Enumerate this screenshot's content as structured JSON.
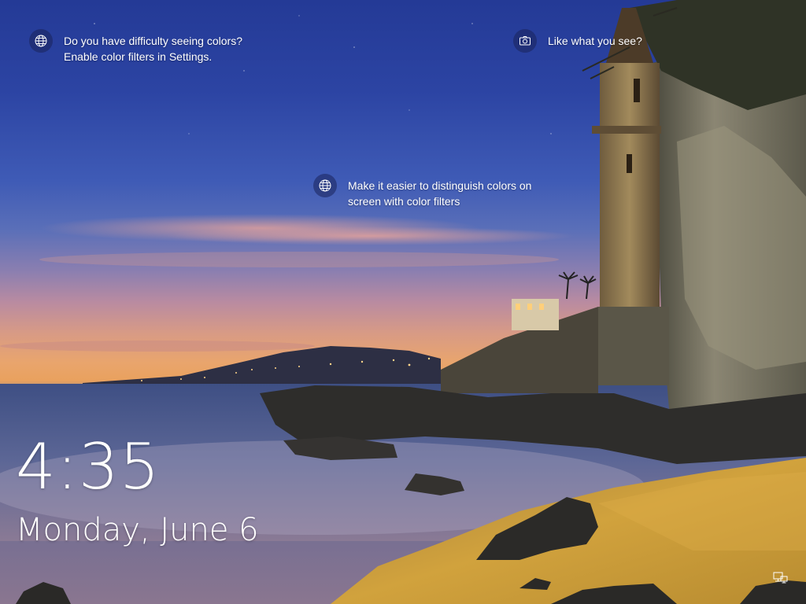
{
  "lock_screen": {
    "tips": [
      {
        "icon": "globe-icon",
        "line1": "Do you have difficulty seeing colors?",
        "line2": "Enable color filters in Settings."
      },
      {
        "icon": "globe-icon",
        "line1": "Make it easier to distinguish colors on",
        "line2": "screen with color filters"
      },
      {
        "icon": "camera-icon",
        "line1": "Like what you see?"
      }
    ],
    "time": "4:35",
    "date": "Monday, June 6",
    "status_icons": [
      "network-icon"
    ]
  },
  "colors": {
    "text": "#ffffff",
    "sky_top": "#243a96",
    "horizon": "#e9a15e",
    "sand": "#c99a35"
  }
}
